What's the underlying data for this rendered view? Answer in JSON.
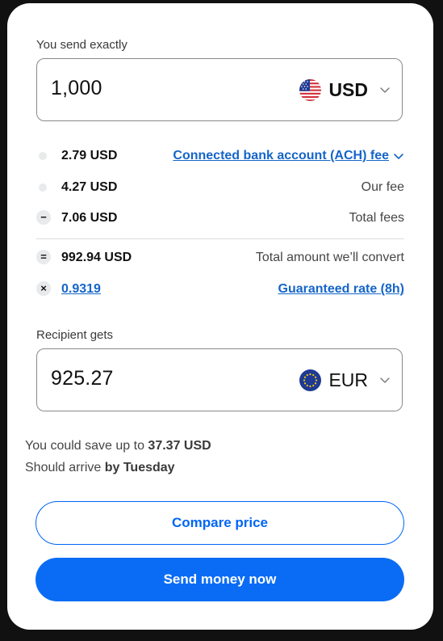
{
  "send": {
    "label": "You send exactly",
    "amount": "1,000",
    "currency": "USD",
    "flag_icon": "us-flag-icon"
  },
  "fees": {
    "bank_fee_value": "2.79 USD",
    "bank_fee_label": "Connected bank account (ACH) fee",
    "our_fee_value": "4.27 USD",
    "our_fee_label": "Our fee",
    "total_fees_value": "7.06 USD",
    "total_fees_label": "Total fees",
    "convert_value": "992.94 USD",
    "convert_label": "Total amount we’ll convert",
    "rate_value": "0.9319",
    "rate_label": "Guaranteed rate (8h)",
    "minus_symbol": "−",
    "equals_symbol": "=",
    "times_symbol": "×"
  },
  "receive": {
    "label": "Recipient gets",
    "amount": "925.27",
    "currency": "EUR",
    "flag_icon": "eu-flag-icon"
  },
  "savings": {
    "prefix": "You could save up to ",
    "amount": "37.37 USD",
    "arrive_prefix": "Should arrive ",
    "arrive_day": "by Tuesday"
  },
  "buttons": {
    "compare": "Compare price",
    "send": "Send money now"
  },
  "colors": {
    "accent": "#0a6cf5",
    "link": "#1565c9",
    "background": "#111111"
  }
}
